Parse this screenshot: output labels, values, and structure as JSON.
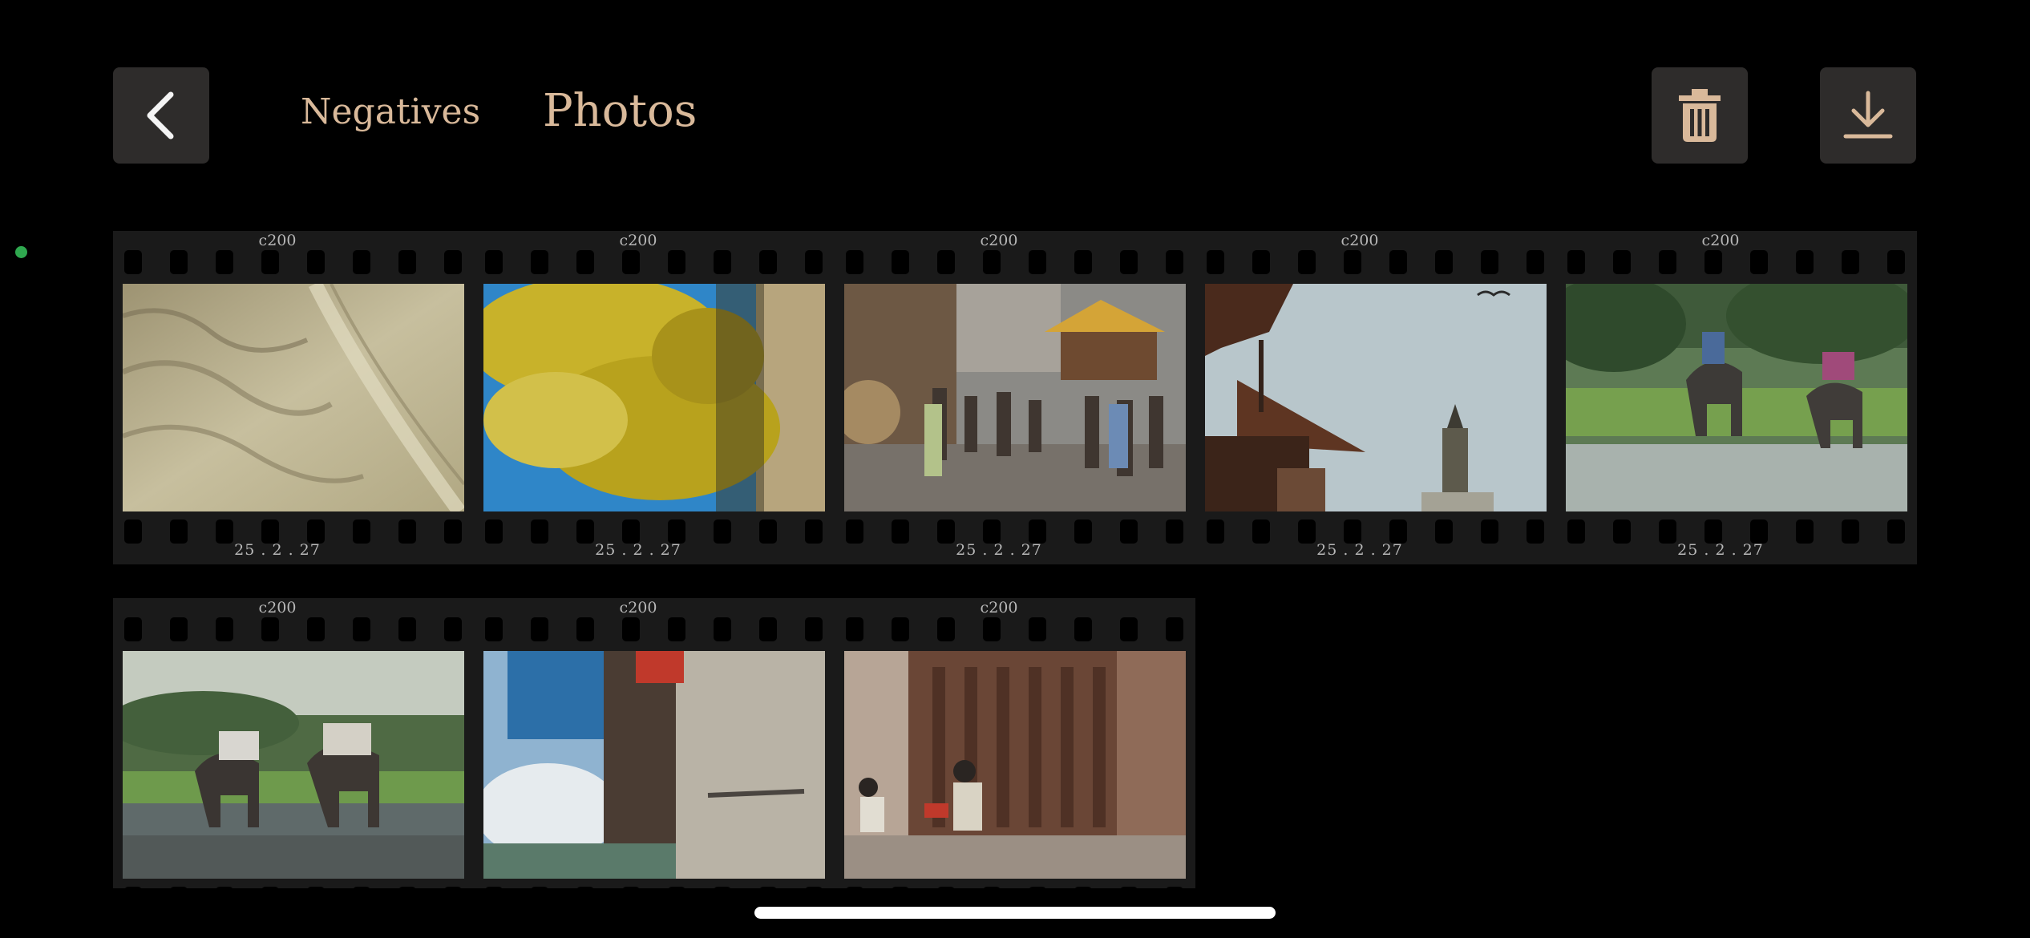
{
  "header": {
    "back_icon": "chevron-left-icon",
    "tabs": [
      {
        "label": "Negatives",
        "active": false
      },
      {
        "label": "Photos",
        "active": true
      }
    ],
    "delete_icon": "trash-icon",
    "download_icon": "download-icon"
  },
  "colors": {
    "background": "#000000",
    "button_bg": "#2e2c2b",
    "tab_text": "#d9b99a",
    "film_base": "#1a1a1a",
    "status_dot": "#2fa84f"
  },
  "strips": [
    {
      "frames": [
        {
          "code": "c200",
          "date": "25 . 2 . 27",
          "subject": "sand dunes"
        },
        {
          "code": "c200",
          "date": "25 . 2 . 27",
          "subject": "yellow tree"
        },
        {
          "code": "c200",
          "date": "25 . 2 . 27",
          "subject": "crowded street"
        },
        {
          "code": "c200",
          "date": "25 . 2 . 27",
          "subject": "temple roof and sky"
        },
        {
          "code": "c200",
          "date": "25 . 2 . 27",
          "subject": "elephants in river"
        }
      ]
    },
    {
      "frames": [
        {
          "code": "c200",
          "date": "",
          "subject": "elephants with riders"
        },
        {
          "code": "c200",
          "date": "",
          "subject": "rotated street view"
        },
        {
          "code": "c200",
          "date": "",
          "subject": "people sitting by carved doorway"
        }
      ]
    }
  ]
}
